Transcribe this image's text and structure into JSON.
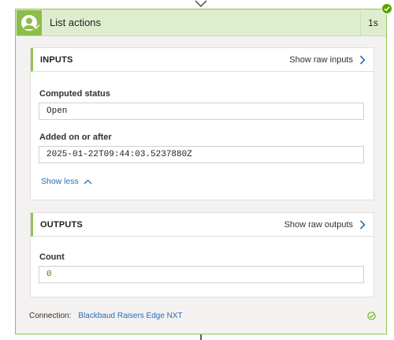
{
  "action": {
    "title": "List actions",
    "duration": "1s",
    "status": "succeeded"
  },
  "inputs": {
    "title": "INPUTS",
    "raw_link": "Show raw inputs",
    "fields": [
      {
        "label": "Computed status",
        "value": "Open"
      },
      {
        "label": "Added on or after",
        "value": "2025-01-22T09:44:03.5237880Z"
      }
    ],
    "show_less": "Show less"
  },
  "outputs": {
    "title": "OUTPUTS",
    "raw_link": "Show raw outputs",
    "fields": [
      {
        "label": "Count",
        "value": "0"
      }
    ]
  },
  "connection": {
    "label": "Connection:",
    "name": "Blackbaud Raisers Edge NXT",
    "status": "connected"
  },
  "colors": {
    "success": "#57a300",
    "accent_green": "#92c353",
    "header_bg": "#dfedcf",
    "link_blue": "#2b6cb8"
  },
  "icons": [
    "chevron-down-arrow-icon",
    "blackbaud-connector-icon",
    "success-check-icon",
    "chevron-right-icon",
    "chevron-up-icon",
    "check-circle-icon"
  ]
}
